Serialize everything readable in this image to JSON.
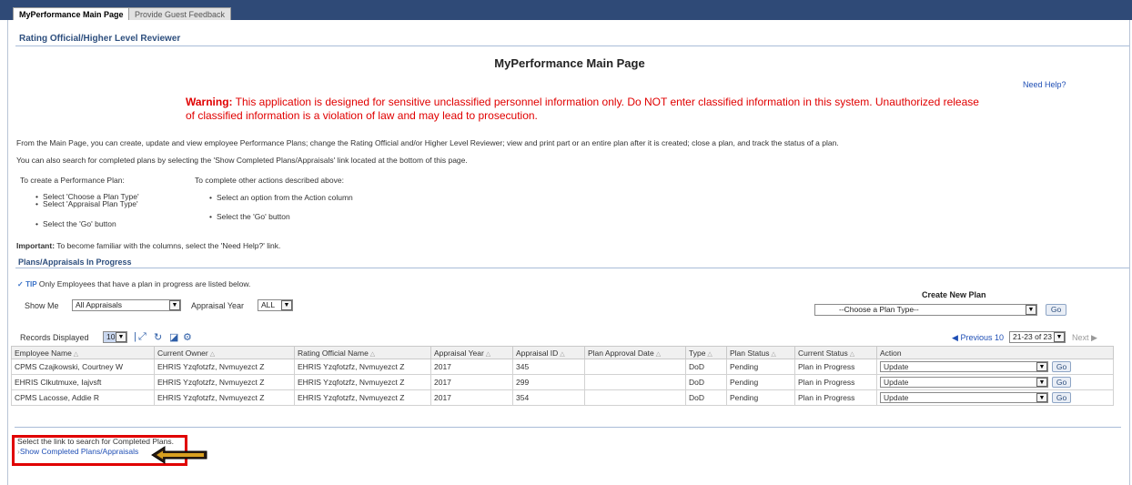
{
  "tabs": [
    {
      "label": "MyPerformance Main Page",
      "active": true
    },
    {
      "label": "Provide Guest Feedback",
      "active": false
    }
  ],
  "region_title": "Rating Official/Higher Level Reviewer",
  "page_title": "MyPerformance Main Page",
  "need_help": "Need Help?",
  "warning": {
    "label": "Warning:",
    "text": " This application is designed for sensitive unclassified personnel information only. Do NOT enter classified information in this system. Unauthorized release of classified information is a violation of law and may lead to prosecution."
  },
  "paragraphs": [
    "From the Main Page, you can create, update and view employee Performance Plans; change the Rating Official and/or Higher Level Reviewer; view and print part or an entire plan after it is created; close a plan, and track the status of a plan.",
    "You can also search for completed plans by selecting the 'Show Completed Plans/Appraisals' link located at the bottom of this page."
  ],
  "instructions": {
    "create": {
      "heading": "To create a Performance Plan:",
      "steps": [
        "Select 'Choose a Plan Type'",
        "Select 'Appraisal Plan Type'",
        "Select the 'Go' button"
      ]
    },
    "other": {
      "heading": "To complete other actions described above:",
      "steps": [
        "Select an option from the Action column",
        "Select the 'Go' button"
      ]
    }
  },
  "important": {
    "label": "Important:",
    "text": " To become familiar with the columns, select the 'Need Help?' link."
  },
  "section_title": "Plans/Appraisals In Progress",
  "tip": {
    "label": "TIP",
    "text": " Only Employees that have a plan in progress are listed below."
  },
  "filters": {
    "show_me_label": "Show Me",
    "show_me_value": "All Appraisals",
    "year_label": "Appraisal Year",
    "year_value": "ALL"
  },
  "create_plan": {
    "label": "Create New Plan",
    "select_value": "--Choose a Plan Type--",
    "go": "Go"
  },
  "records": {
    "label": "Records Displayed",
    "value": "10"
  },
  "pager": {
    "previous": "Previous 10",
    "range": "21-23 of 23",
    "next": "Next"
  },
  "table": {
    "columns": [
      "Employee Name",
      "Current Owner",
      "Rating Official Name",
      "Appraisal Year",
      "Appraisal ID",
      "Plan Approval Date",
      "Type",
      "Plan Status",
      "Current Status",
      "Action"
    ],
    "rows": [
      [
        "CPMS Czajkowski, Courtney W",
        "EHRIS Yzqfotzfz, Nvmuyezct Z",
        "EHRIS Yzqfotzfz, Nvmuyezct Z",
        "2017",
        "345",
        "",
        "DoD",
        "Pending",
        "Plan in Progress",
        "Update"
      ],
      [
        "EHRIS Clkutmuxe, Iajvsft",
        "EHRIS Yzqfotzfz, Nvmuyezct Z",
        "EHRIS Yzqfotzfz, Nvmuyezct Z",
        "2017",
        "299",
        "",
        "DoD",
        "Pending",
        "Plan in Progress",
        "Update"
      ],
      [
        "CPMS Lacosse, Addie R",
        "EHRIS Yzqfotzfz, Nvmuyezct Z",
        "EHRIS Yzqfotzfz, Nvmuyezct Z",
        "2017",
        "354",
        "",
        "DoD",
        "Pending",
        "Plan in Progress",
        "Update"
      ]
    ],
    "row_go": "Go"
  },
  "bottom": {
    "text": "Select the link to search for Completed Plans.",
    "link": "Show Completed Plans/Appraisals"
  },
  "colors": {
    "header_bar": "#2f4a77",
    "warning": "#e00000",
    "highlight": "#e00000",
    "link": "#1f4fb5"
  }
}
